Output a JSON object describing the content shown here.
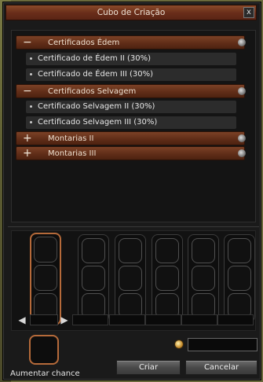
{
  "window": {
    "title": "Cubo de Criação",
    "close_label": "x"
  },
  "categories": [
    {
      "sign": "−",
      "label": "Certificados Édem",
      "items": [
        "Certificado de Édem II (30%)",
        "Certificado de Édem III (30%)"
      ]
    },
    {
      "sign": "−",
      "label": "Certificados Selvagem",
      "items": [
        "Certificado Selvagem II (30%)",
        "Certificado Selvagem III (30%)"
      ]
    },
    {
      "sign": "+",
      "label": "Montarias II",
      "items": []
    },
    {
      "sign": "+",
      "label": "Montarias III",
      "items": []
    }
  ],
  "nav": {
    "prev_label": "◀",
    "next_label": "▶"
  },
  "chance": {
    "label": "Aumentar chance"
  },
  "buttons": {
    "create_label": "Criar",
    "cancel_label": "Cancelar"
  },
  "icons": {
    "coin": "coin-icon",
    "close": "close-icon"
  }
}
